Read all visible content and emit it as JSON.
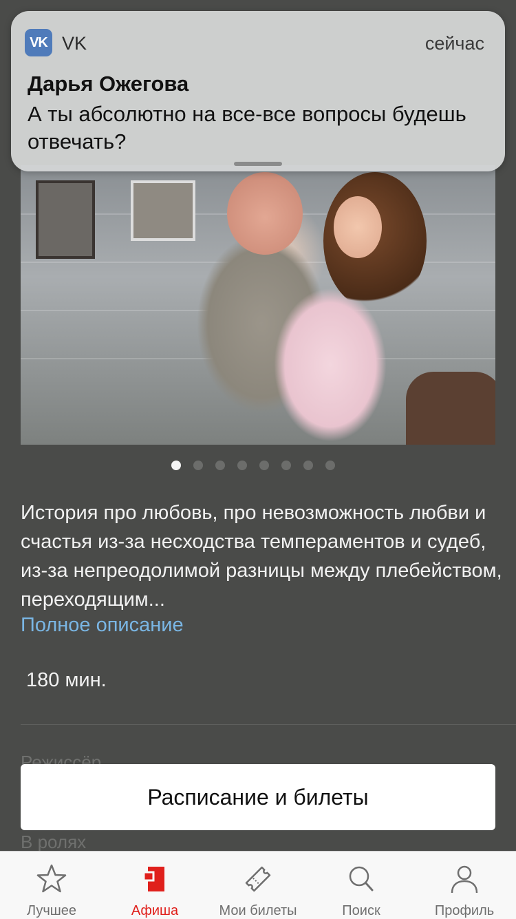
{
  "notification": {
    "app_icon_text": "VK",
    "app_name": "VK",
    "time": "сейчас",
    "sender": "Дарья Ожегова",
    "message": "А ты абсолютно на все-все вопросы будешь отвечать?"
  },
  "gallery": {
    "total": 8,
    "active_index": 0
  },
  "description": {
    "text": "История про любовь, про невозможность любви и счастья из-за несходства темпераментов и судеб, из-за непреодолимой разницы между плебейством, переходящим...",
    "more_link": "Полное описание"
  },
  "duration": "180 мин.",
  "labels": {
    "director": "Режиссёр",
    "cast": "В ролях"
  },
  "cta_label": "Расписание и билеты",
  "tabbar": {
    "active": "Афиша",
    "accent_color": "#e0201c",
    "items": [
      {
        "label": "Лучшее",
        "icon": "star-icon"
      },
      {
        "label": "Афиша",
        "icon": "poster-icon"
      },
      {
        "label": "Мои билеты",
        "icon": "ticket-icon"
      },
      {
        "label": "Поиск",
        "icon": "search-icon"
      },
      {
        "label": "Профиль",
        "icon": "profile-icon"
      }
    ]
  }
}
